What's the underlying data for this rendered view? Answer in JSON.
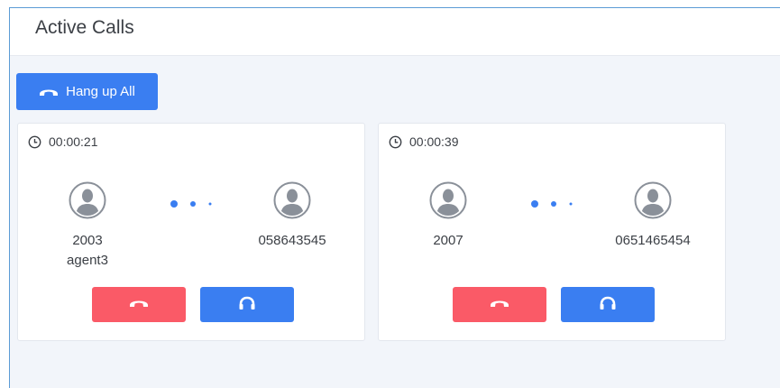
{
  "header": {
    "title": "Active Calls"
  },
  "toolbar": {
    "hangup_all_label": "Hang up All",
    "hangup_icon": "phone-hangup-icon"
  },
  "calls": [
    {
      "duration": "00:00:21",
      "caller": "2003",
      "caller_name": "agent3",
      "callee": "058643545"
    },
    {
      "duration": "00:00:39",
      "caller": "2007",
      "caller_name": "",
      "callee": "0651465454"
    }
  ],
  "colors": {
    "accent": "#3a7ef1",
    "hangup": "#fa5a67",
    "frame": "#5b9bd5"
  }
}
